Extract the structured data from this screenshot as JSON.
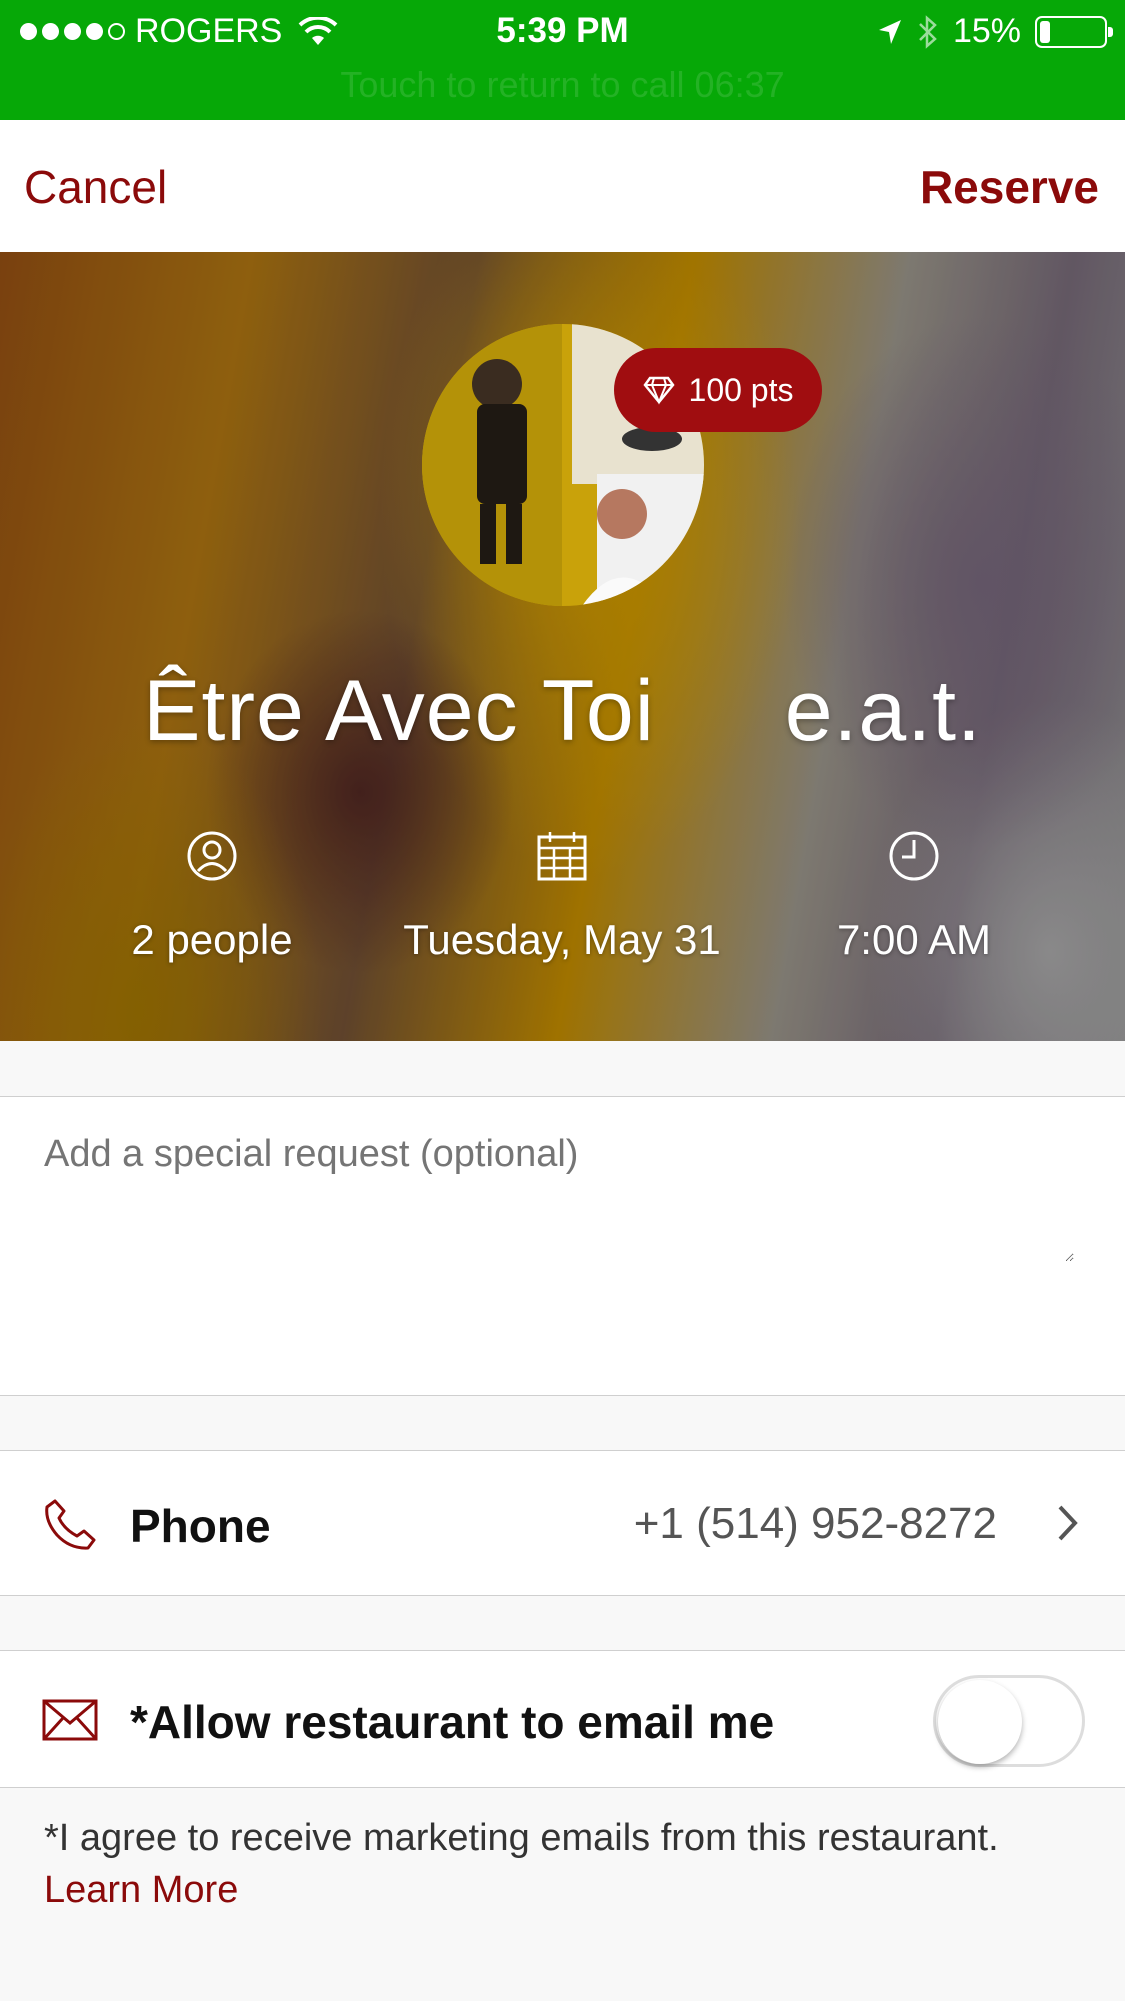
{
  "status_bar": {
    "carrier": "ROGERS",
    "signal_bars_filled": 4,
    "signal_bars_total": 5,
    "time": "5:39 PM",
    "battery": "15%",
    "battery_level": 0.15,
    "call_banner": "Touch to return to call  06:37",
    "background_color": "#06a807"
  },
  "nav": {
    "cancel_label": "Cancel",
    "reserve_label": "Reserve",
    "accent_color": "#8b0a0a"
  },
  "hero": {
    "points_badge": "100 pts",
    "restaurant_name": "Être Avec Toi",
    "restaurant_suffix": "e.a.t.",
    "party_size": "2 people",
    "date": "Tuesday, May 31",
    "time": "7:00 AM"
  },
  "request": {
    "placeholder": "Add a special request (optional)"
  },
  "phone": {
    "label": "Phone",
    "value": "+1 (514) 952-8272"
  },
  "email": {
    "label": "*Allow restaurant to email me",
    "toggle_on": false
  },
  "note": {
    "text": "*I agree to receive marketing emails from this restaurant.",
    "link": "Learn More"
  },
  "icons": [
    "wifi-icon",
    "location-arrow-icon",
    "bluetooth-icon",
    "battery-icon",
    "diamond-icon",
    "person-icon",
    "calendar-icon",
    "clock-icon",
    "phone-icon",
    "envelope-icon",
    "chevron-right-icon"
  ]
}
